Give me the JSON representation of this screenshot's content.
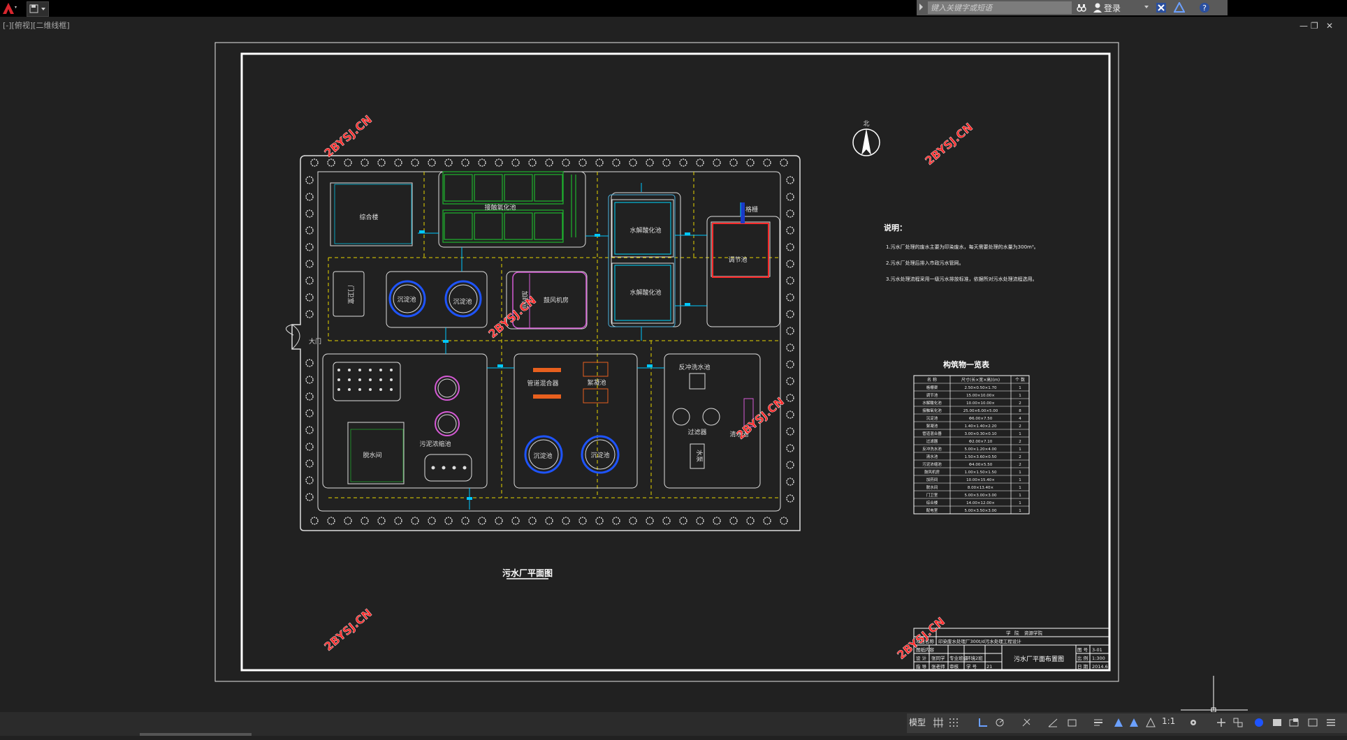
{
  "app": {
    "search_placeholder": "键入关键字或短语",
    "login_label": "登录",
    "view_label": "[-][俯视][二维线框]"
  },
  "drawing": {
    "buildings": {
      "zonghelou": "综合楼",
      "jiechuyanghua": "接触氧化池",
      "shuijie1": "水解酸化池",
      "shuijie2": "水解酸化池",
      "tiaojie": "调节池",
      "geshan": "格栅",
      "menwei": "门卫室",
      "chendian1": "沉淀池",
      "chendian2": "沉淀池",
      "gufengjifang": "鼓风机房",
      "jiayao": "加药间",
      "damen": "大门",
      "tuoshuijian": "脱水间",
      "wuninongsuo": "污泥浓缩池",
      "guandaohunhe": "管道混合器",
      "xuningchi": "絮凝池",
      "chendian3": "沉淀池",
      "chendian4": "沉淀池",
      "fanchongxi": "反冲洗水池",
      "guolvqi": "过滤器",
      "shuibeng": "水泵",
      "qingshui": "清水池"
    },
    "drawing_title": "污水厂平面图",
    "north_label": "北",
    "notes": {
      "heading": "说明：",
      "items": [
        "1.污水厂处理的废水主要为印染废水，每天需要处理的水量为300m³。",
        "2.污水厂处理后排入市政污水管网。",
        "3.污水处理流程采用一级污水排放标准，依据所对污水处理流程选用。"
      ]
    },
    "table": {
      "title": "构筑物一览表",
      "headers": [
        "名 称",
        "尺寸(长×宽×高)(m)",
        "个 数"
      ],
      "rows": [
        [
          "格栅渠",
          "2.50×0.50×1.70",
          "1"
        ],
        [
          "调节池",
          "15.00×10.00×",
          "1"
        ],
        [
          "水解酸化池",
          "10.00×10.00×",
          "2"
        ],
        [
          "接触氧化池",
          "25.00×6.00×5.00",
          "8"
        ],
        [
          "沉淀池",
          "Φ6.00×7.50",
          "4"
        ],
        [
          "絮凝池",
          "1.40×1.40×2.20",
          "2"
        ],
        [
          "管道混合器",
          "3.00×0.30×0.10",
          "1"
        ],
        [
          "过滤器",
          "Φ2.00×7.10",
          "2"
        ],
        [
          "反冲洗水池",
          "5.00×1.20×4.00",
          "1"
        ],
        [
          "清水池",
          "1.50×3.60×0.50",
          "2"
        ],
        [
          "污泥浓缩池",
          "Φ4.00×5.50",
          "2"
        ],
        [
          "鼓风机房",
          "1.00×1.50×1.50",
          "1"
        ],
        [
          "加药间",
          "10.00×15.40×",
          "1"
        ],
        [
          "脱水间",
          "8.00×13.40×",
          "1"
        ],
        [
          "门卫室",
          "5.00×3.00×3.00",
          "1"
        ],
        [
          "综合楼",
          "14.00×12.00×",
          "1"
        ],
        [
          "配电室",
          "5.00×3.50×3.00",
          "1"
        ]
      ]
    },
    "titleblock": {
      "row1": [
        "学",
        "院",
        "资源学院"
      ],
      "project_label": "项目名称",
      "project_value": "印染废水处理厂300t/d污水处理工程设计",
      "content_label": "图纸内容",
      "designer_label": "设 计",
      "designer": "张同学",
      "major_label": "专业班级",
      "major": "环境2班",
      "drawing_no_label": "图 号",
      "drawing_no": "3-01",
      "teacher_label": "指 导",
      "teacher": "张老师",
      "checker_label": "审核",
      "scale_label": "比 例",
      "scale": "1:300",
      "stu_no_label": "学 号",
      "stu_no": "21",
      "date_label": "日 期",
      "date": "2014.6",
      "sheet_title": "污水厂平面布置图"
    },
    "watermark": "2BYSJ.CN"
  },
  "statusbar": {
    "model_label": "模型",
    "scale_label": "1:1"
  }
}
